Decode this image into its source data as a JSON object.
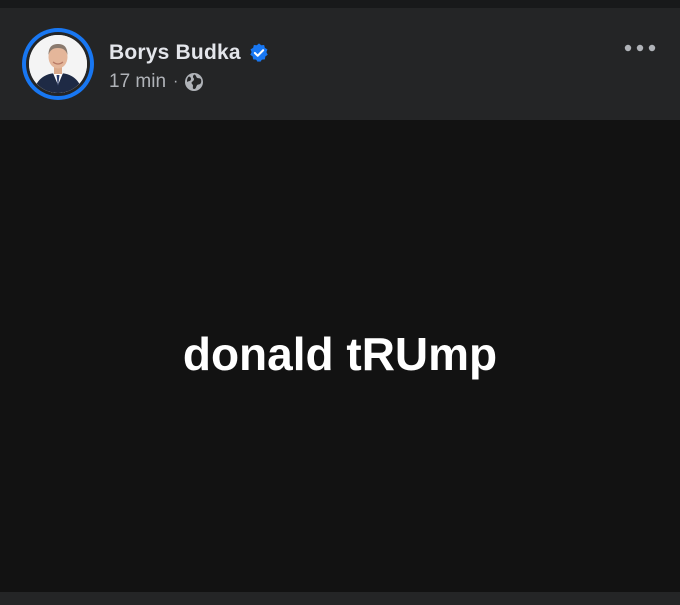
{
  "post": {
    "author": "Borys Budka",
    "timestamp": "17 min",
    "separator": "·",
    "audience_icon": "globe-icon",
    "verified_icon": "verified-badge-icon",
    "more_icon": "more-options-icon",
    "text": "donald tRUmp"
  },
  "colors": {
    "background": "#18191a",
    "header": "#242526",
    "canvas": "#121212",
    "accent": "#1877f2",
    "text_primary": "#e4e6eb",
    "text_secondary": "#b0b3b8"
  }
}
